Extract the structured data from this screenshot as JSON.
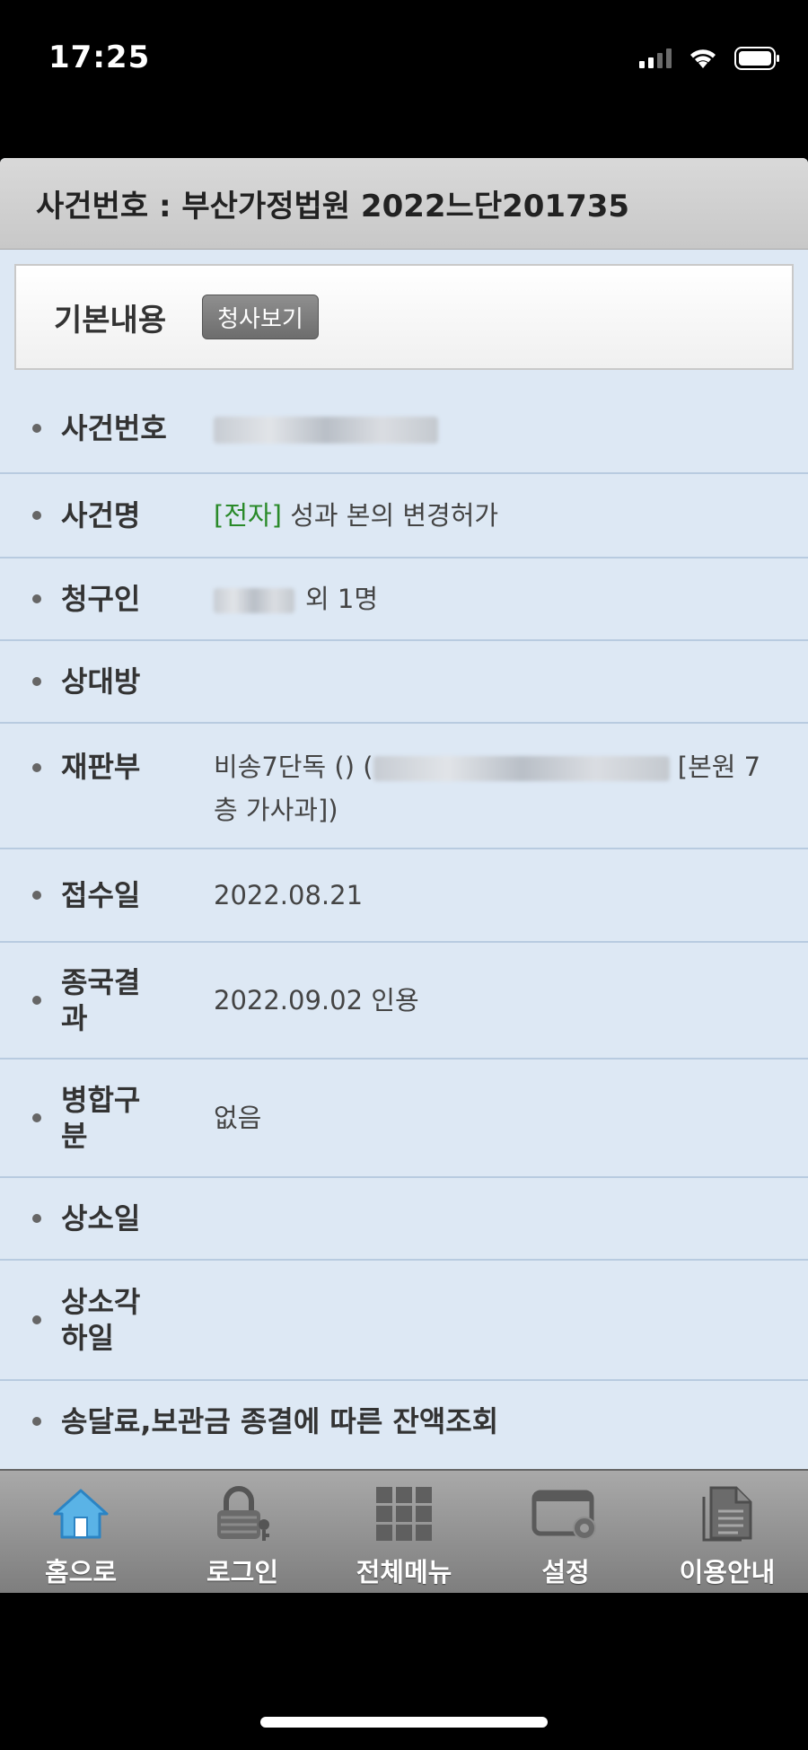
{
  "status": {
    "time": "17:25"
  },
  "header": {
    "title": "사건번호 : 부산가정법원 2022느단201735"
  },
  "basic": {
    "label": "기본내용",
    "button": "청사보기"
  },
  "rows": [
    {
      "key": "사건번호",
      "value": ""
    },
    {
      "key": "사건명",
      "value_tag": "[전자]",
      "value": " 성과 본의 변경허가"
    },
    {
      "key": "청구인",
      "value": "외 1명"
    },
    {
      "key": "상대방",
      "value": ""
    },
    {
      "key": "재판부",
      "value_pre": "비송7단독 () (",
      "value_post": " [본원 7층 가사과])"
    },
    {
      "key": "접수일",
      "value": "2022.08.21"
    },
    {
      "key": "종국결과",
      "value": "2022.09.02 인용"
    },
    {
      "key": "병합구분",
      "value": "없음"
    },
    {
      "key": "상소일",
      "value": ""
    },
    {
      "key": "상소각하일",
      "value": ""
    },
    {
      "key": "송달료,보관금 종결에 따른 잔액조회",
      "value": ""
    }
  ],
  "nav": [
    {
      "label": "홈으로",
      "icon": "home-icon"
    },
    {
      "label": "로그인",
      "icon": "lock-icon"
    },
    {
      "label": "전체메뉴",
      "icon": "grid-icon"
    },
    {
      "label": "설정",
      "icon": "settings-icon"
    },
    {
      "label": "이용안내",
      "icon": "document-icon"
    }
  ]
}
